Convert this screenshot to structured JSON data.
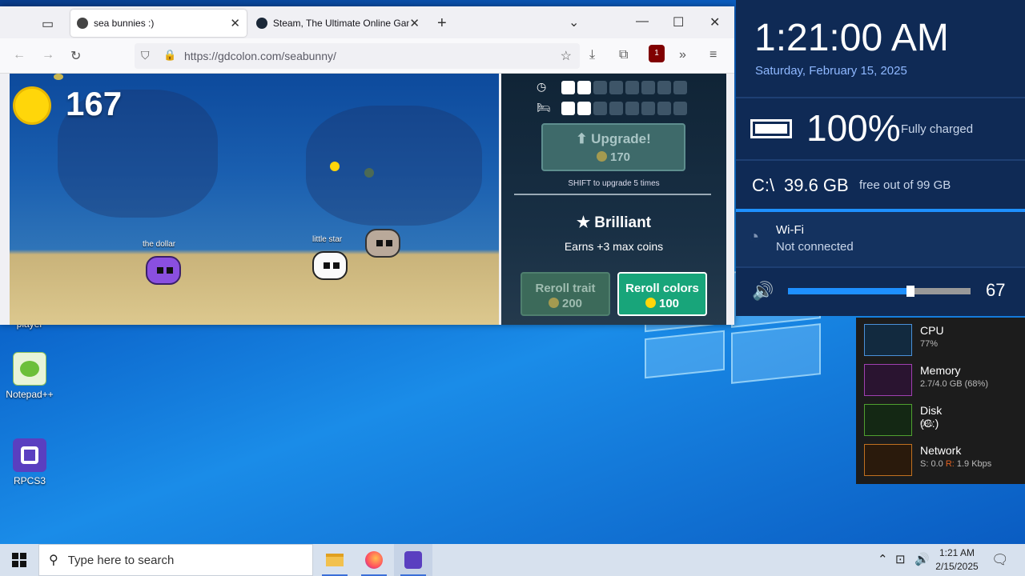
{
  "browser": {
    "tabs": [
      {
        "title": "sea bunnies :)",
        "active": true
      },
      {
        "title": "Steam, The Ultimate Online Gan",
        "active": false
      }
    ],
    "new_tab": "+",
    "url": "https://gdcolon.com/seabunny/",
    "extension_badge": "1"
  },
  "game": {
    "coins": "167",
    "bunnies": [
      "the dollar",
      "little star"
    ],
    "stats": {
      "time_on": 2,
      "time_total": 8,
      "sleep_on": 2,
      "sleep_total": 8
    },
    "upgrade_label": "Upgrade!",
    "upgrade_cost": "170",
    "shift_hint": "SHIFT to upgrade 5 times",
    "trait_name": "Brilliant",
    "trait_desc": "Earns +3 max coins",
    "reroll_trait_label": "Reroll trait",
    "reroll_trait_cost": "200",
    "reroll_colors_label": "Reroll colors",
    "reroll_colors_cost": "100"
  },
  "gadgets": {
    "time": "1:21:00 AM",
    "date": "Saturday, February 15, 2025",
    "battery_pct": "100%",
    "battery_status": "Fully charged",
    "drive_label": "C:\\",
    "drive_free": "39.6 GB",
    "drive_total": "free out of 99 GB",
    "wifi_title": "Wi-Fi",
    "wifi_status": "Not connected",
    "volume": "67",
    "volume_level": 0.67,
    "perf": [
      {
        "name": "CPU",
        "value": "77%",
        "color": "#4a90d9"
      },
      {
        "name": "Memory",
        "value": "2.7/4.0 GB (68%)",
        "color": "#a040b0"
      },
      {
        "name": "Disk (C:)",
        "value": "0%",
        "color": "#50a030"
      },
      {
        "name": "Network",
        "value_s": "S: 0.0",
        "value_r_label": "R:",
        "value_r": "1.9 Kbps",
        "color": "#c07020"
      }
    ]
  },
  "desktop": {
    "icons": [
      {
        "label": "player"
      },
      {
        "label": "Notepad++"
      },
      {
        "label": "RPCS3"
      }
    ]
  },
  "taskbar": {
    "search_placeholder": "Type here to search",
    "time": "1:21 AM",
    "date": "2/15/2025"
  }
}
